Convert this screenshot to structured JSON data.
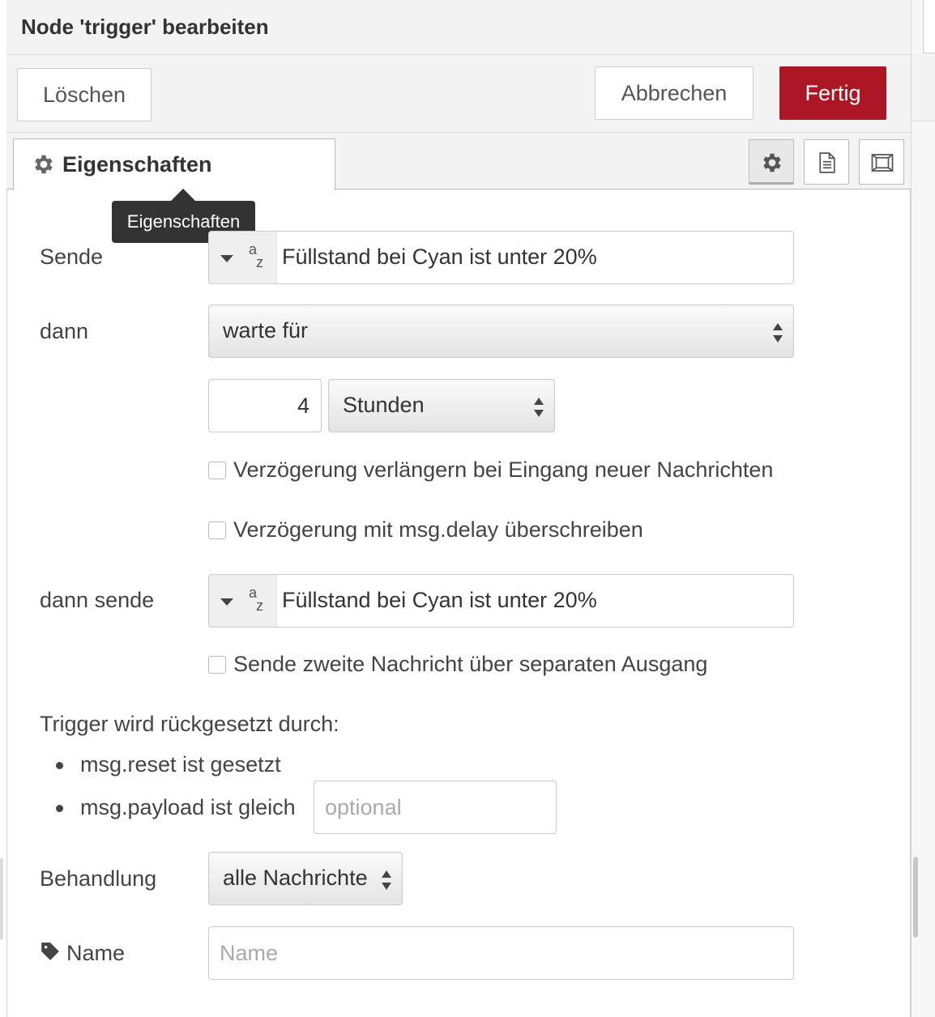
{
  "header": {
    "title": "Node 'trigger' bearbeiten"
  },
  "toolbar": {
    "delete_label": "Löschen",
    "cancel_label": "Abbrechen",
    "done_label": "Fertig"
  },
  "colors": {
    "primary_button": "#ad1625"
  },
  "tabs": {
    "active_label": "Eigenschaften",
    "icons": [
      "gear-icon",
      "document-icon",
      "frame-icon"
    ],
    "tooltip": "Eigenschaften"
  },
  "form": {
    "send_label": "Sende",
    "send_type_icon": "string-type-icon",
    "send_value": "Füllstand bei Cyan ist unter 20%",
    "then_label": "dann",
    "then_value": "warte für",
    "duration_value": "4",
    "duration_unit": "Stunden",
    "extend_delay_label": "Verzögerung verlängern bei Eingang neuer Nachrichten",
    "extend_delay_checked": false,
    "override_delay_label": "Verzögerung mit msg.delay überschreiben",
    "override_delay_checked": false,
    "then_send_label": "dann sende",
    "then_send_value": "Füllstand bei Cyan ist unter 20%",
    "second_output_label": "Sende zweite Nachricht über separaten Ausgang",
    "second_output_checked": false,
    "reset_heading": "Trigger wird rückgesetzt durch:",
    "reset_item_1": "msg.reset ist gesetzt",
    "reset_item_2": "msg.payload ist gleich",
    "reset_payload_placeholder": "optional",
    "handling_label": "Behandlung",
    "handling_value": "alle Nachrichten",
    "name_label": "Name",
    "name_placeholder": "Name"
  }
}
